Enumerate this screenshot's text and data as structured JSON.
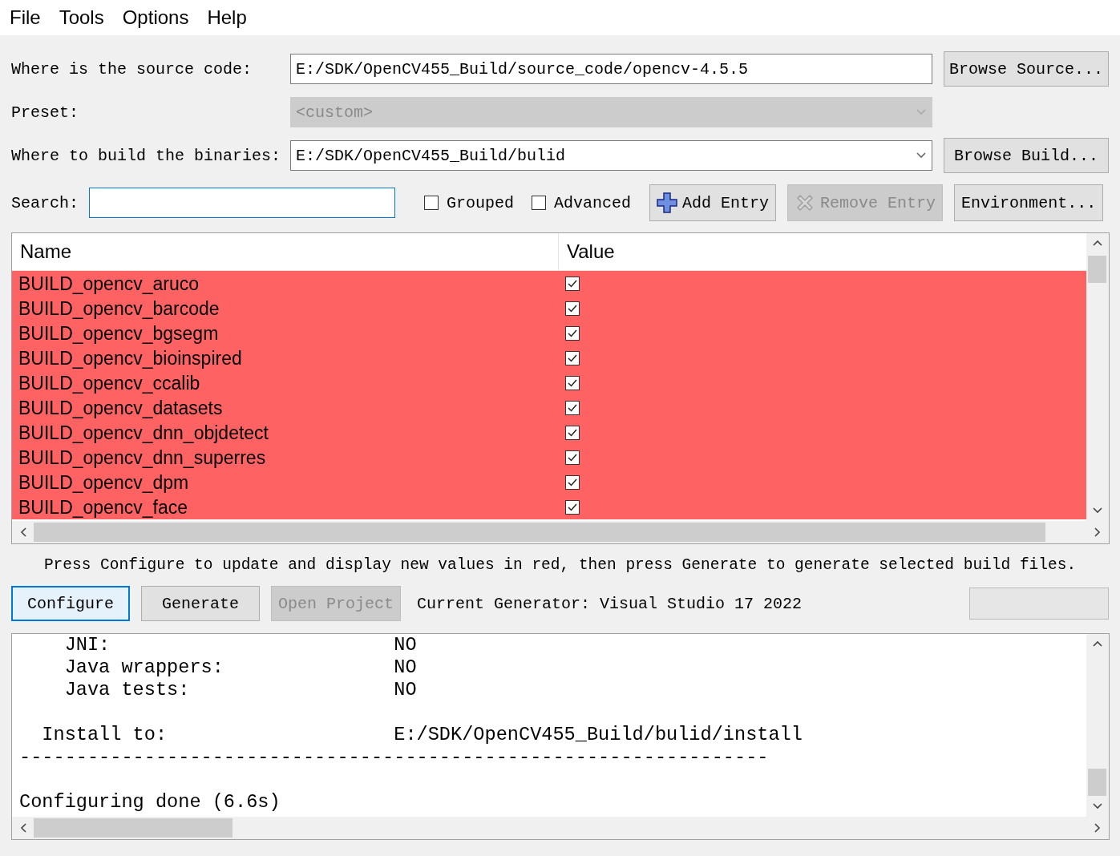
{
  "menu": [
    {
      "label": "File"
    },
    {
      "label": "Tools"
    },
    {
      "label": "Options"
    },
    {
      "label": "Help"
    }
  ],
  "source": {
    "label": "Where is the source code:",
    "value": "E:/SDK/OpenCV455_Build/source_code/opencv-4.5.5",
    "button": "Browse Source..."
  },
  "preset": {
    "label": "Preset:",
    "value": "<custom>",
    "disabled": true
  },
  "build": {
    "label": "Where to build the binaries:",
    "value": "E:/SDK/OpenCV455_Build/bulid",
    "button": "Browse Build..."
  },
  "search": {
    "label": "Search:"
  },
  "options": [
    {
      "label": "Grouped",
      "checked": false
    },
    {
      "label": "Advanced",
      "checked": false
    }
  ],
  "entry_buttons": [
    {
      "label": "Add Entry",
      "kind": "add",
      "disabled": false
    },
    {
      "label": "Remove Entry",
      "kind": "remove",
      "disabled": true
    },
    {
      "label": "Environment...",
      "kind": "plain",
      "disabled": false
    }
  ],
  "table": {
    "columns": [
      "Name",
      "Value"
    ],
    "rows": [
      {
        "name": "BUILD_opencv_aruco",
        "checked": true,
        "is_new": true
      },
      {
        "name": "BUILD_opencv_barcode",
        "checked": true,
        "is_new": true
      },
      {
        "name": "BUILD_opencv_bgsegm",
        "checked": true,
        "is_new": true
      },
      {
        "name": "BUILD_opencv_bioinspired",
        "checked": true,
        "is_new": true
      },
      {
        "name": "BUILD_opencv_ccalib",
        "checked": true,
        "is_new": true
      },
      {
        "name": "BUILD_opencv_datasets",
        "checked": true,
        "is_new": true
      },
      {
        "name": "BUILD_opencv_dnn_objdetect",
        "checked": true,
        "is_new": true
      },
      {
        "name": "BUILD_opencv_dnn_superres",
        "checked": true,
        "is_new": true
      },
      {
        "name": "BUILD_opencv_dpm",
        "checked": true,
        "is_new": true
      },
      {
        "name": "BUILD_opencv_face",
        "checked": true,
        "is_new": true
      }
    ]
  },
  "message": "Press Configure to update and display new values in red, then press Generate to generate selected build files.",
  "actions": [
    {
      "label": "Configure",
      "focused": true,
      "disabled": false
    },
    {
      "label": "Generate",
      "focused": false,
      "disabled": false
    },
    {
      "label": "Open Project",
      "focused": false,
      "disabled": true
    }
  ],
  "generator": "Current Generator: Visual Studio 17 2022",
  "progress": {
    "level": 0
  },
  "log": {
    "blocks": [
      [
        "    JNI:                         NO",
        "    Java wrappers:               NO",
        "    Java tests:                  NO"
      ],
      [
        "  Install to:                    E:/SDK/OpenCV455_Build/bulid/install",
        "------------------------------------------------------------------"
      ],
      [
        "Configuring done (6.6s)"
      ]
    ]
  }
}
